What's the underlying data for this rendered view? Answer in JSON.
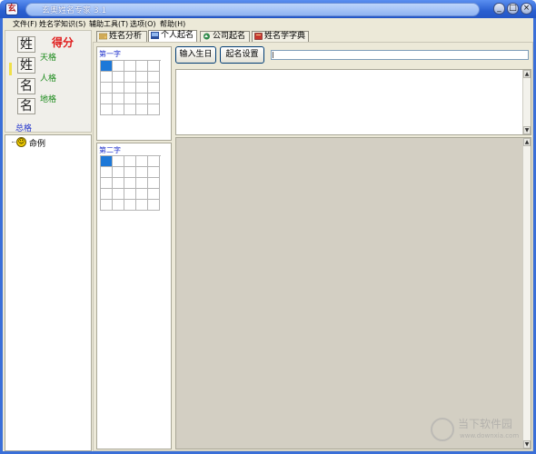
{
  "window": {
    "title": "玄奥姓名专家 3.1",
    "app_icon_glyph": "玄"
  },
  "window_controls": {
    "minimize": "_",
    "maximize": "□",
    "close": "×"
  },
  "menu": [
    {
      "label": "文件(F)"
    },
    {
      "label": "姓名学知识(S)"
    },
    {
      "label": "辅助工具(T)"
    },
    {
      "label": "选项(O)"
    },
    {
      "label": "帮助(H)"
    }
  ],
  "score_panel": {
    "title": "得分",
    "chars": [
      "姓",
      "姓",
      "名",
      "名"
    ],
    "grades": {
      "tian": "天格",
      "ren": "人格",
      "di": "地格",
      "zong": "总格"
    },
    "title_color": "#e01b1b",
    "grade_color": "#1a8a1a",
    "total_color": "#2233cc"
  },
  "tree": {
    "items": [
      {
        "label": "命例",
        "icon": "smiley-icon"
      }
    ]
  },
  "tabs": [
    {
      "label": "姓名分析",
      "icon": "analysis-icon",
      "active": false
    },
    {
      "label": "个人起名",
      "icon": "person-icon",
      "active": true
    },
    {
      "label": "公司起名",
      "icon": "company-icon",
      "active": false
    },
    {
      "label": "姓名学字典",
      "icon": "dictionary-icon",
      "active": false
    }
  ],
  "first_char": {
    "label": "第一字"
  },
  "second_char": {
    "label": "第二字"
  },
  "toolbar": {
    "birthday_button": "输入生日",
    "settings_button": "起名设置",
    "input_value": ""
  },
  "scroll_arrows": {
    "up": "▲",
    "down": "▼"
  },
  "watermark": {
    "title": "当下软件园",
    "subtitle": "www.downxia.com"
  },
  "colors": {
    "title_bar": "#2a5fd0",
    "selection": "#1d78d8",
    "panel_bg": "#ece9d8",
    "result_bg": "#d3cfc3"
  }
}
